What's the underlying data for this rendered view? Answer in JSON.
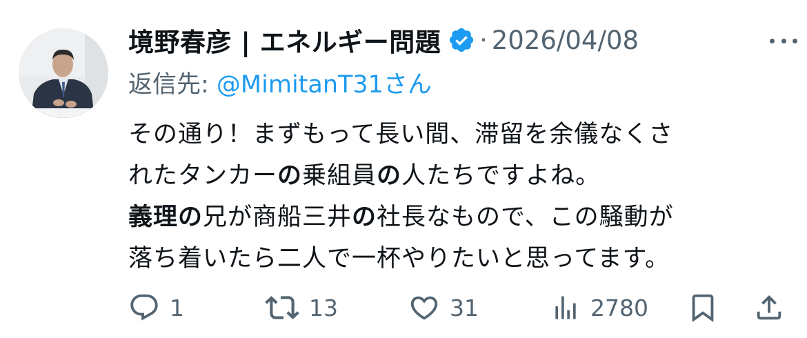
{
  "author": {
    "display_name": "境野春彦 | エネルギー問題",
    "verified": true
  },
  "separator": "·",
  "date": "2026/04/08",
  "reply_to": {
    "prefix": "返信先: ",
    "handle": "@MimitanT31",
    "suffix": "さん"
  },
  "body": {
    "line1": "その通り！まずもって長い間、滞留を余儀なくさ",
    "line2_a": "れたタンカー",
    "line2_b": "の",
    "line2_c": "乗組員",
    "line2_d": "の",
    "line2_e": "人たちですよね。",
    "line3_a": "義理の",
    "line3_b": "兄が商船三井",
    "line3_c": "の",
    "line3_d": "社長なもので、この騒動が",
    "line4": "落ち着いたら二人で一杯やりたいと思ってます。"
  },
  "actions": {
    "reply_count": "1",
    "retweet_count": "13",
    "like_count": "31",
    "views_count": "2780"
  },
  "icons": {
    "reply": "reply-icon",
    "retweet": "retweet-icon",
    "like": "heart-icon",
    "views": "views-icon",
    "bookmark": "bookmark-icon",
    "share": "share-icon",
    "more": "more-icon",
    "verified": "verified-badge-icon"
  },
  "colors": {
    "text": "#0f1419",
    "secondary": "#536471",
    "link": "#1d9bf0",
    "verified": "#1d9bf0"
  }
}
